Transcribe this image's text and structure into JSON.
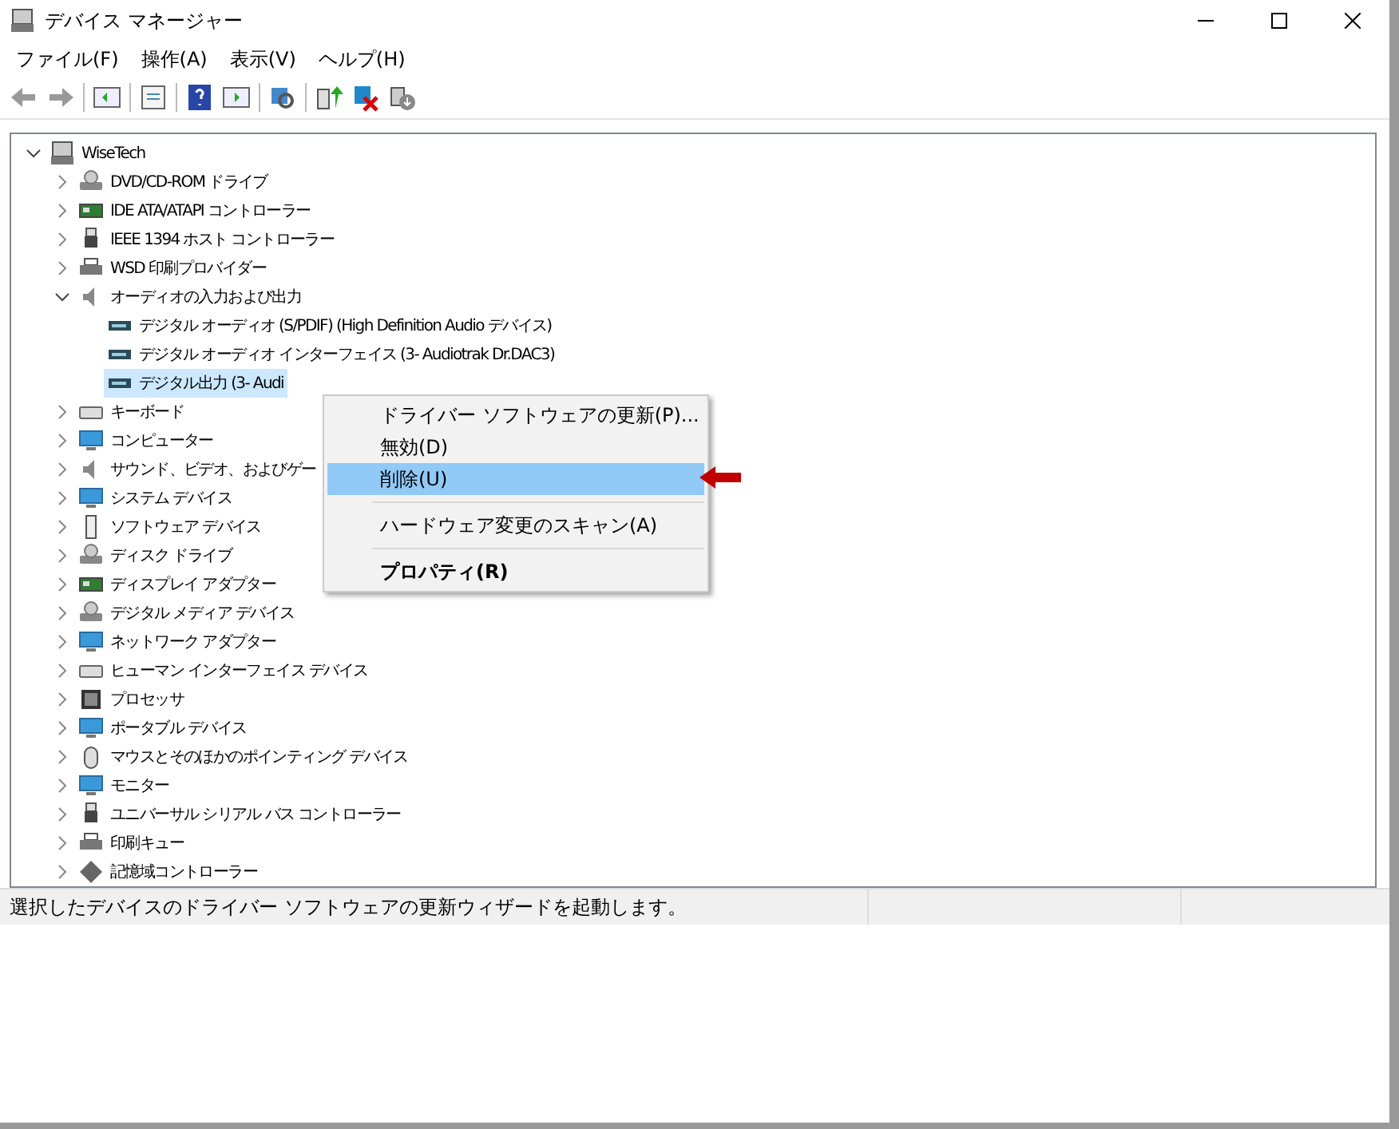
{
  "window": {
    "title": "デバイス マネージャー"
  },
  "menu_bar": [
    {
      "label": "ファイル(F)"
    },
    {
      "label": "操作(A)"
    },
    {
      "label": "表示(V)"
    },
    {
      "label": "ヘルプ(H)"
    }
  ],
  "tree": {
    "label": "WiseTech",
    "expanded": true,
    "selected": false,
    "children": [
      {
        "label": "DVD/CD-ROM ドライブ",
        "expanded": false,
        "selected": false
      },
      {
        "label": "IDE ATA/ATAPI コントローラー",
        "expanded": false,
        "selected": false
      },
      {
        "label": "IEEE 1394 ホスト コントローラー",
        "expanded": false,
        "selected": false
      },
      {
        "label": "WSD 印刷プロバイダー",
        "expanded": false,
        "selected": false
      },
      {
        "label": "オーディオの入力および出力",
        "expanded": true,
        "selected": false,
        "children": [
          {
            "label": "デジタル オーディオ (S/PDIF) (High Definition Audio デバイス)",
            "selected": false
          },
          {
            "label": "デジタル オーディオ インターフェイス (3- Audiotrak Dr.DAC3)",
            "selected": false
          },
          {
            "label": "デジタル出力 (3- Audi",
            "selected": true
          }
        ]
      },
      {
        "label": "キーボード",
        "expanded": false,
        "selected": false
      },
      {
        "label": "コンピューター",
        "expanded": false,
        "selected": false
      },
      {
        "label": "サウンド、ビデオ、およびゲー",
        "expanded": false,
        "selected": false
      },
      {
        "label": "システム デバイス",
        "expanded": false,
        "selected": false
      },
      {
        "label": "ソフトウェア デバイス",
        "expanded": false,
        "selected": false
      },
      {
        "label": "ディスク ドライブ",
        "expanded": false,
        "selected": false
      },
      {
        "label": "ディスプレイ アダプター",
        "expanded": false,
        "selected": false
      },
      {
        "label": "デジタル メディア デバイス",
        "expanded": false,
        "selected": false
      },
      {
        "label": "ネットワーク アダプター",
        "expanded": false,
        "selected": false
      },
      {
        "label": "ヒューマン インターフェイス デバイス",
        "expanded": false,
        "selected": false
      },
      {
        "label": "プロセッサ",
        "expanded": false,
        "selected": false
      },
      {
        "label": "ポータブル デバイス",
        "expanded": false,
        "selected": false
      },
      {
        "label": "マウスとそのほかのポインティング デバイス",
        "expanded": false,
        "selected": false
      },
      {
        "label": "モニター",
        "expanded": false,
        "selected": false
      },
      {
        "label": "ユニバーサル シリアル バス コントローラー",
        "expanded": false,
        "selected": false
      },
      {
        "label": "印刷キュー",
        "expanded": false,
        "selected": false
      },
      {
        "label": "記憶域コントローラー",
        "expanded": false,
        "selected": false
      }
    ]
  },
  "context_menu": [
    {
      "kind": "item",
      "label": "ドライバー ソフトウェアの更新(P)...",
      "selected": false,
      "default": false
    },
    {
      "kind": "item",
      "label": "無効(D)",
      "selected": false,
      "default": false
    },
    {
      "kind": "item",
      "label": "削除(U)",
      "selected": true,
      "default": false
    },
    {
      "kind": "separator"
    },
    {
      "kind": "item",
      "label": "ハードウェア変更のスキャン(A)",
      "selected": false,
      "default": false
    },
    {
      "kind": "separator"
    },
    {
      "kind": "item",
      "label": "プロパティ(R)",
      "selected": false,
      "default": true
    }
  ],
  "status_bar": {
    "text": "選択したデバイスのドライバー ソフトウェアの更新ウィザードを起動します。"
  }
}
